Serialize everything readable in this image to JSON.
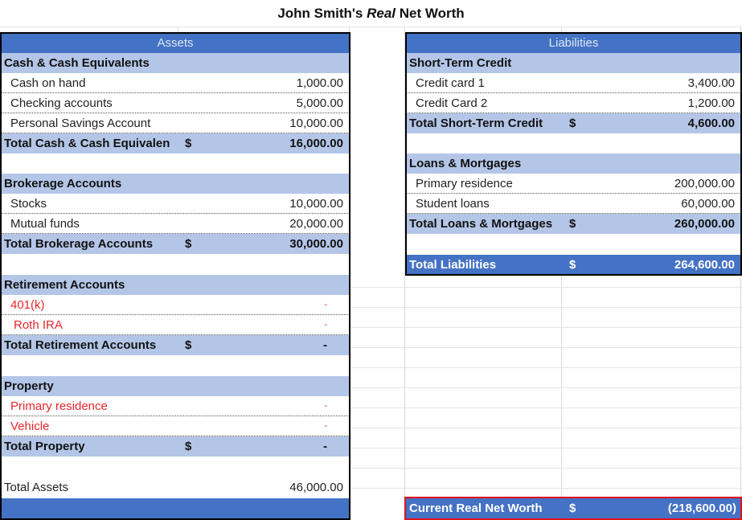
{
  "title": {
    "prefix": "John Smith's",
    "emph": "Real",
    "suffix": "Net Worth"
  },
  "assets": {
    "header": "Assets",
    "cash": {
      "title": "Cash & Cash Equivalents",
      "items": [
        {
          "label": "Cash on hand",
          "amount": "1,000.00"
        },
        {
          "label": "Checking accounts",
          "amount": "5,000.00"
        },
        {
          "label": "Personal Savings Account",
          "amount": "10,000.00"
        }
      ],
      "total_label": "Total Cash & Cash Equivalen",
      "total_cur": "$",
      "total_amount": "16,000.00"
    },
    "brokerage": {
      "title": "Brokerage Accounts",
      "items": [
        {
          "label": "Stocks",
          "amount": "10,000.00"
        },
        {
          "label": "Mutual funds",
          "amount": "20,000.00"
        }
      ],
      "total_label": "Total Brokerage Accounts",
      "total_cur": "$",
      "total_amount": "30,000.00"
    },
    "retirement": {
      "title": "Retirement Accounts",
      "items": [
        {
          "label": "401(k)",
          "amount": "-"
        },
        {
          "label": "Roth IRA",
          "amount": "-"
        }
      ],
      "total_label": "Total Retirement Accounts",
      "total_cur": "$",
      "total_amount": "-"
    },
    "property": {
      "title": "Property",
      "items": [
        {
          "label": "Primary  residence",
          "amount": "-"
        },
        {
          "label": "Vehicle",
          "amount": "-"
        }
      ],
      "total_label": "Total Property",
      "total_cur": "$",
      "total_amount": "-"
    },
    "total_label": "Total Assets",
    "total_amount": "46,000.00"
  },
  "liabilities": {
    "header": "Liabilities",
    "short_term": {
      "title": "Short-Term Credit",
      "items": [
        {
          "label": "Credit card 1",
          "amount": "3,400.00"
        },
        {
          "label": "Credit Card 2",
          "amount": "1,200.00"
        }
      ],
      "total_label": "Total Short-Term Credit",
      "total_cur": "$",
      "total_amount": "4,600.00"
    },
    "loans": {
      "title": "Loans & Mortgages",
      "items": [
        {
          "label": "Primary  residence",
          "amount": "200,000.00"
        },
        {
          "label": "Student loans",
          "amount": "60,000.00"
        }
      ],
      "total_label": "Total Loans & Mortgages",
      "total_cur": "$",
      "total_amount": "260,000.00"
    },
    "total_label": "Total Liabilities",
    "total_cur": "$",
    "total_amount": "264,600.00"
  },
  "net_worth": {
    "label": "Current Real Net Worth",
    "cur": "$",
    "amount": "(218,600.00)"
  },
  "colors": {
    "header_blue": "#4472c4",
    "section_blue": "#b4c6e7",
    "alert_red": "#e0121c"
  }
}
